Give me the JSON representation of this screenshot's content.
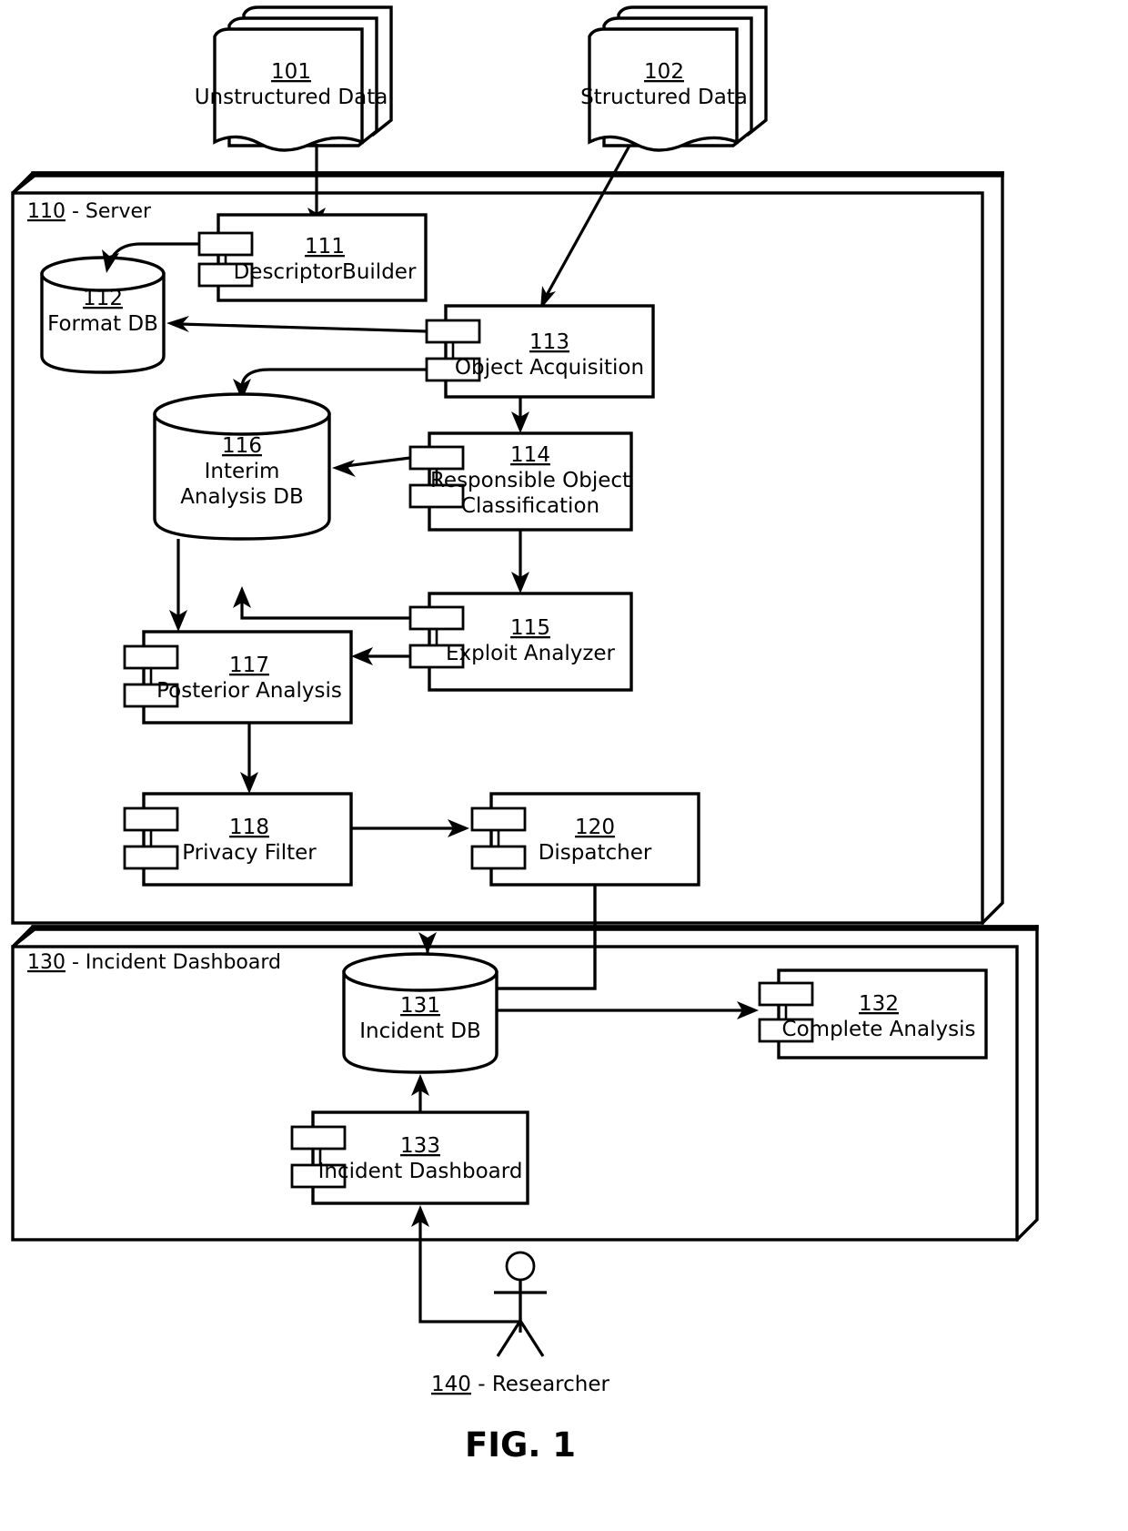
{
  "figure": {
    "caption": "FIG. 1"
  },
  "inputs": [
    {
      "num": "101",
      "label": "Unstructured Data",
      "icon": "document-stack-icon"
    },
    {
      "num": "102",
      "label": "Structured Data",
      "icon": "document-stack-icon"
    }
  ],
  "regions": [
    {
      "id": "server",
      "num": "110",
      "separator": "-",
      "label": "Server",
      "title": "110 - Server"
    },
    {
      "id": "dashboard",
      "num": "130",
      "separator": "-",
      "label": "Incident Dashboard",
      "title": "130 - Incident Dashboard"
    }
  ],
  "components": [
    {
      "num": "111",
      "label": "DescriptorBuilder",
      "shape": "component"
    },
    {
      "num": "113",
      "label": "Object Acquisition",
      "shape": "component"
    },
    {
      "num": "114",
      "label": "Responsible Object",
      "label2": "Classification",
      "shape": "component"
    },
    {
      "num": "115",
      "label": "Exploit Analyzer",
      "shape": "component"
    },
    {
      "num": "117",
      "label": "Posterior Analysis",
      "shape": "component"
    },
    {
      "num": "118",
      "label": "Privacy Filter",
      "shape": "component"
    },
    {
      "num": "120",
      "label": "Dispatcher",
      "shape": "component"
    },
    {
      "num": "132",
      "label": "Complete Analysis",
      "shape": "component"
    },
    {
      "num": "133",
      "label": "Incident Dashboard",
      "shape": "component"
    }
  ],
  "databases": [
    {
      "num": "112",
      "label": "Format DB",
      "shape": "cylinder"
    },
    {
      "num": "116",
      "label": "Interim",
      "label2": "Analysis DB",
      "shape": "cylinder"
    },
    {
      "num": "131",
      "label": "Incident DB",
      "shape": "cylinder"
    }
  ],
  "actor": {
    "num": "140",
    "separator": "-",
    "label": "Researcher",
    "title": "140 - Researcher"
  },
  "colors": {
    "stroke": "#000000",
    "background": "#ffffff"
  }
}
